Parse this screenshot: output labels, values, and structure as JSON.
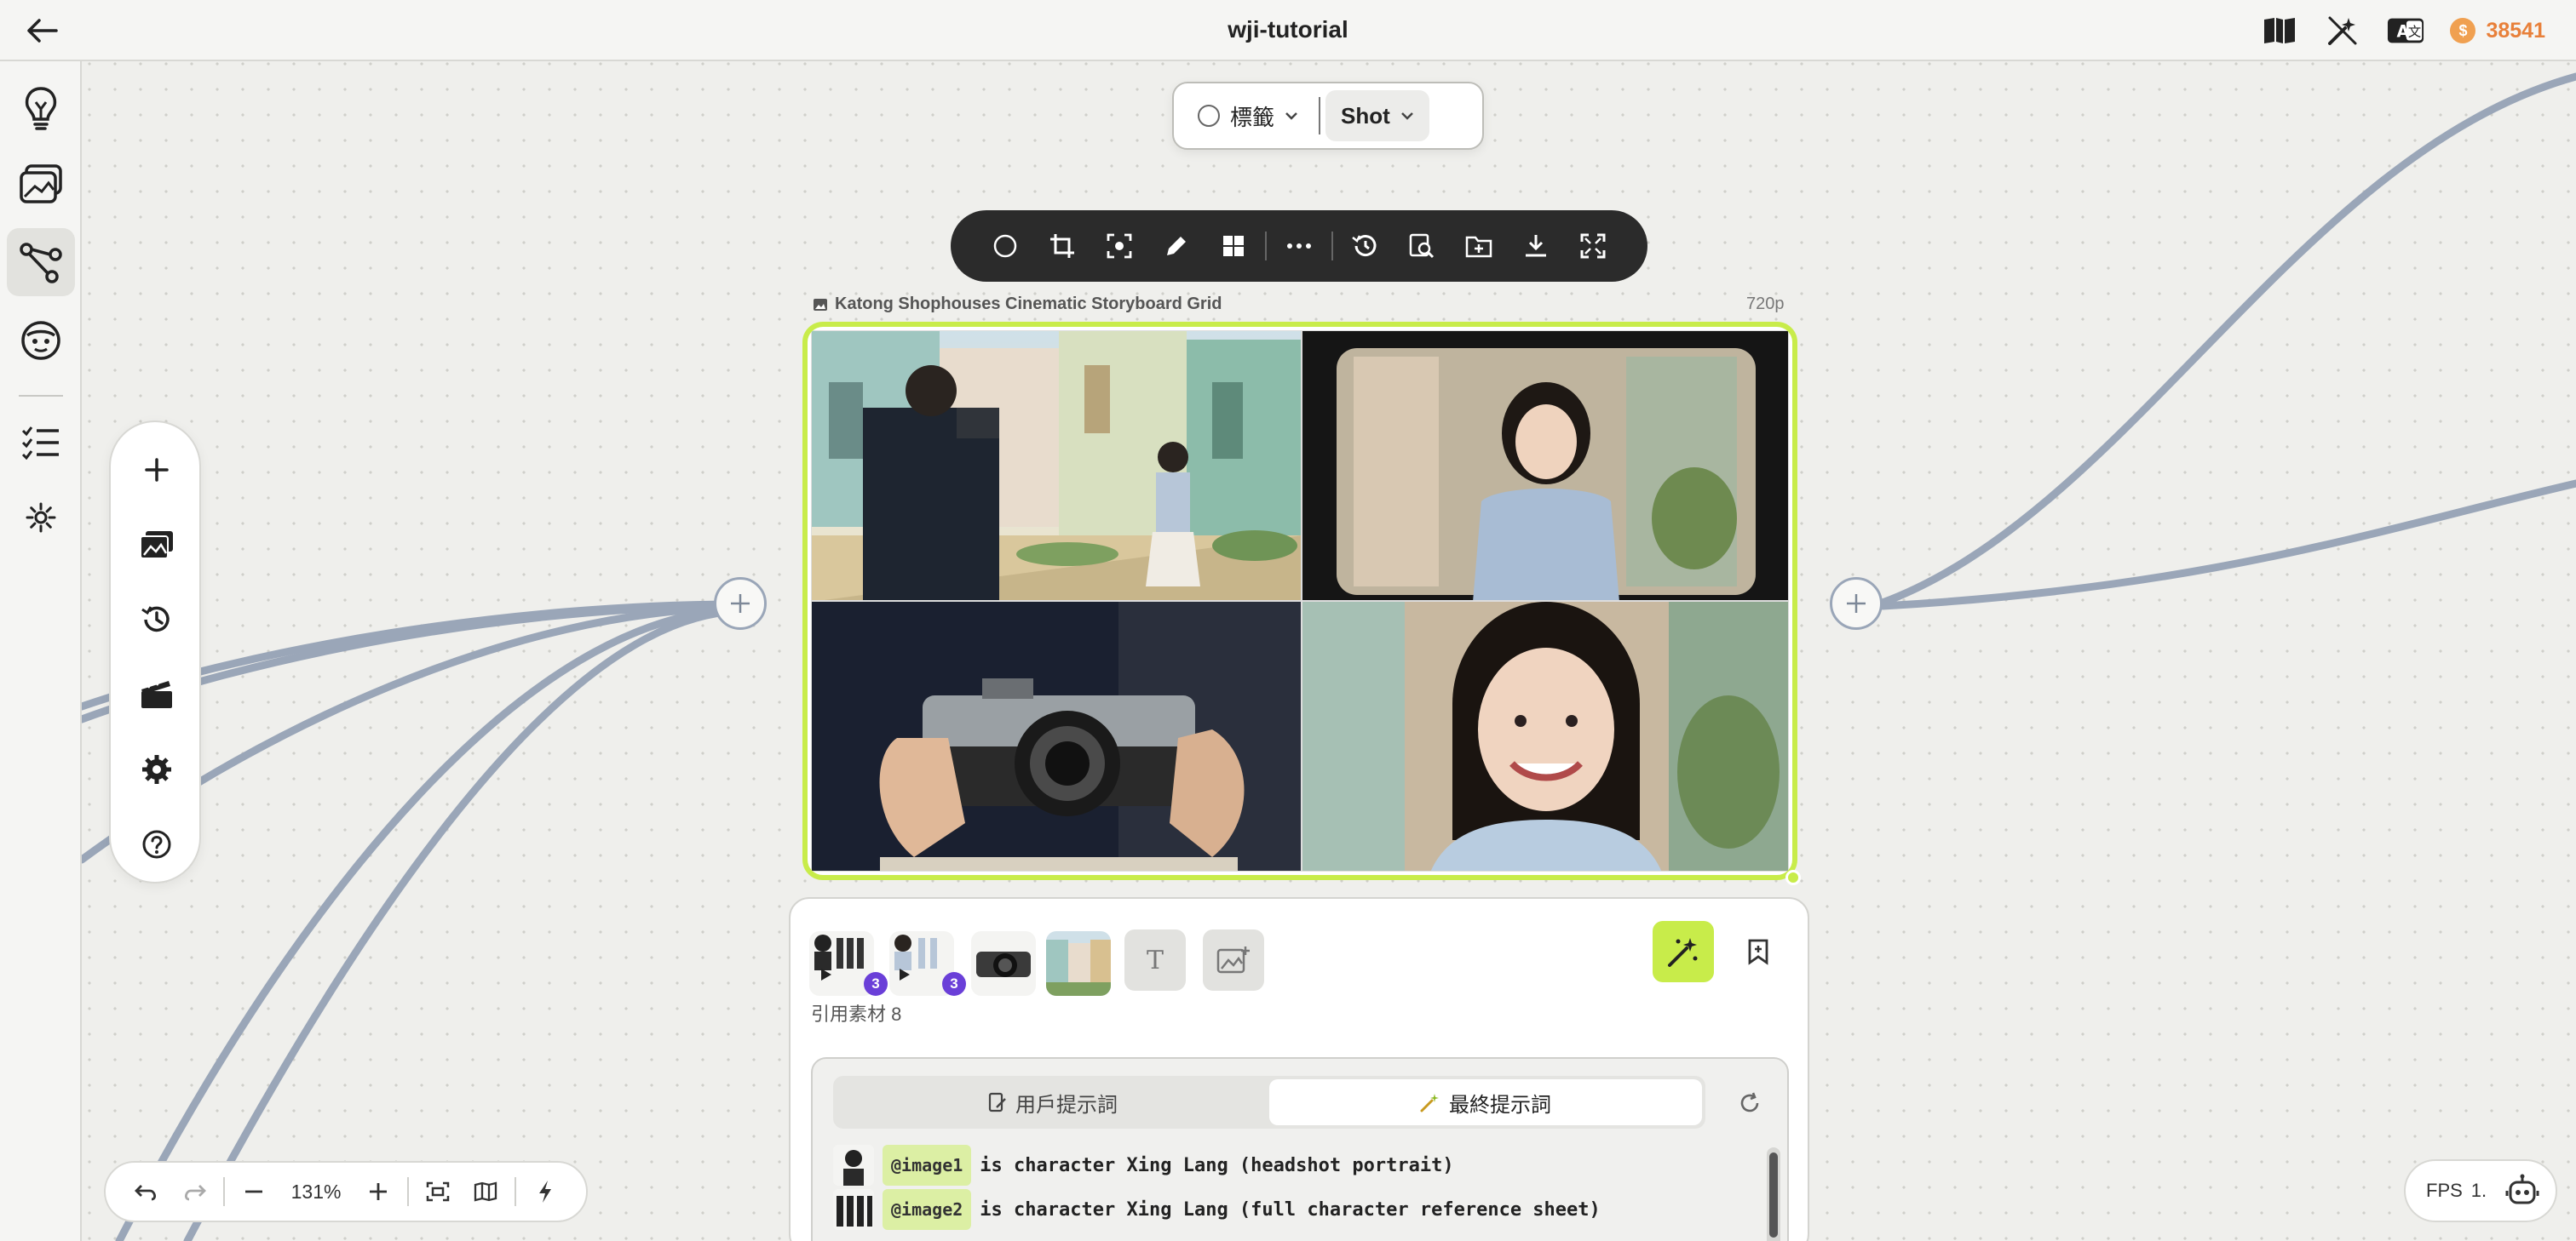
{
  "window": {
    "title": "wji-tutorial"
  },
  "header": {
    "credits": "38541",
    "coin_symbol": "$"
  },
  "segment": {
    "tag_label": "標籤",
    "shot_label": "Shot"
  },
  "node": {
    "title": "Katong Shophouses Cinematic Storyboard Grid",
    "resolution": "720p"
  },
  "zoom": {
    "level": "131%"
  },
  "prompt": {
    "ref_count_label": "引用素材 8",
    "badge_a": "3",
    "badge_b": "3",
    "text_button_label": "T",
    "tabs": [
      {
        "label": "用戶提示詞",
        "active": false
      },
      {
        "label": "最終提示詞",
        "active": true
      }
    ],
    "lines": [
      {
        "tag": "@image1",
        "text": "is character Xing Lang (headshot portrait)"
      },
      {
        "tag": "@image2",
        "text": "is character Xing Lang (full character reference sheet)"
      }
    ]
  },
  "fps": {
    "label": "FPS",
    "value": "1."
  },
  "colors": {
    "accent": "#c8ec4a",
    "credit": "#e8803a",
    "badge": "#6a3fd8",
    "wire": "#9aa6b8"
  }
}
